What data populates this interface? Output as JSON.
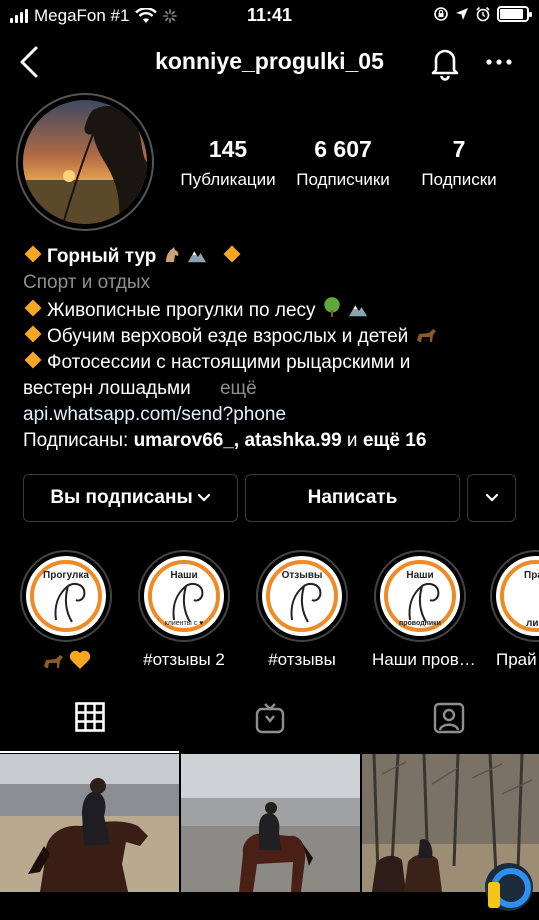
{
  "status_bar": {
    "carrier": "MegaFon #1",
    "time": "11:41",
    "battery_level": 0.9
  },
  "header": {
    "username": "konniye_progulki_05",
    "icons": [
      "back-arrow-icon",
      "bell-icon",
      "more-icon"
    ]
  },
  "stats": {
    "posts": {
      "value": "145",
      "label": "Публикации"
    },
    "followers": {
      "value": "6 607",
      "label": "Подписчики"
    },
    "following": {
      "value": "7",
      "label": "Подписки"
    }
  },
  "bio": {
    "name": "Горный тур",
    "category": "Спорт и отдых",
    "line1": "Живописные прогулки по лесу",
    "line2": "Обучим верховой езде взрослых и детей",
    "line3": "Фотосессии с настоящими рыцарскими и",
    "line4": "вестерн лошадьми",
    "more": "ещё",
    "link": "api.whatsapp.com/send?phone",
    "followed_prefix": "Подписаны: ",
    "followed_users": "umarov66_, atashka.99",
    "followed_mid": " и ",
    "followed_more": "ещё 16"
  },
  "buttons": {
    "following": "Вы подписаны",
    "message": "Написать"
  },
  "highlights": [
    {
      "title": "Прогулка",
      "label": ""
    },
    {
      "title": "Наши",
      "subtitle": "клиенты с ♥",
      "label": "#отзывы 2"
    },
    {
      "title": "Отзывы",
      "label": "#отзывы"
    },
    {
      "title": "Наши",
      "subtitle": "проводники",
      "label": "Наши пров…"
    },
    {
      "title": "Пра",
      "subtitle": "ли",
      "label": "Прай"
    }
  ],
  "tabs": [
    "grid-icon",
    "igtv-icon",
    "tagged-icon"
  ],
  "colors": {
    "background": "#000000",
    "accent_orange": "#f08a24",
    "diamond": "#f5a623",
    "link": "#e0f1ff",
    "muted": "#8e8e8e"
  }
}
